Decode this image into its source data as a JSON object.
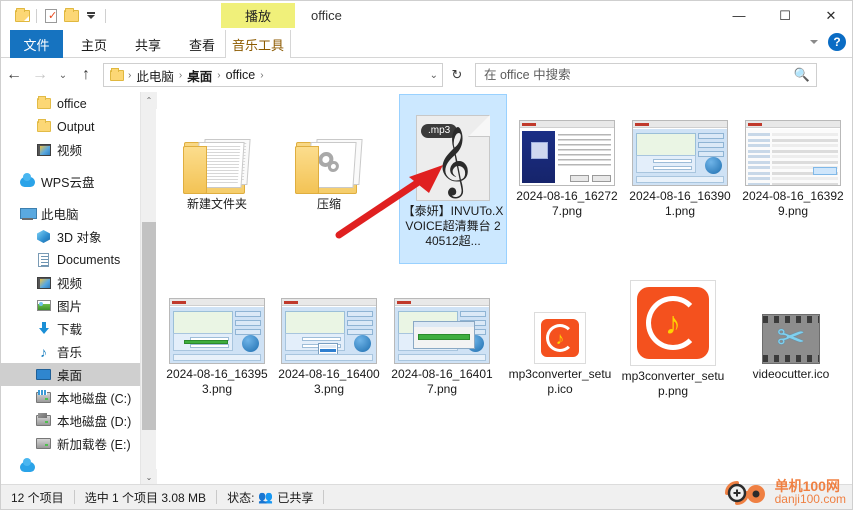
{
  "window": {
    "title": "office",
    "contextual_tab_group": "播放",
    "minimize": "—",
    "maximize": "☐",
    "close": "✕"
  },
  "quick_access": {
    "folder_icon": "folder-icon",
    "properties_icon": "properties-icon",
    "new_folder_icon": "new-folder-icon",
    "customize_icon": "customize-dropdown-icon"
  },
  "ribbon": {
    "tabs": [
      {
        "label": "文件",
        "active": true
      },
      {
        "label": "主页",
        "active": false
      },
      {
        "label": "共享",
        "active": false
      },
      {
        "label": "查看",
        "active": false
      },
      {
        "label": "音乐工具",
        "active": false
      }
    ],
    "collapse_icon": "chevron-down-icon",
    "help_label": "?"
  },
  "address": {
    "back_icon": "←",
    "forward_icon": "→",
    "recent_icon": "⌄",
    "up_icon": "↑",
    "breadcrumbs": [
      "此电脑",
      "桌面",
      "office"
    ],
    "separator": "›",
    "dropdown_icon": "⌄",
    "refresh_icon": "↻"
  },
  "search": {
    "placeholder": "在 office 中搜索",
    "value": "",
    "icon": "search-icon"
  },
  "sidebar": {
    "items": [
      {
        "label": "office",
        "icon": "folder-icon",
        "indent": 2,
        "selected": false
      },
      {
        "label": "Output",
        "icon": "folder-icon",
        "indent": 2,
        "selected": false
      },
      {
        "label": "视频",
        "icon": "video-icon",
        "indent": 2,
        "selected": false
      },
      {
        "label": "WPS云盘",
        "icon": "cloud-icon",
        "indent": 1,
        "selected": false
      },
      {
        "label": "此电脑",
        "icon": "pc-icon",
        "indent": 1,
        "selected": false
      },
      {
        "label": "3D 对象",
        "icon": "3d-objects-icon",
        "indent": 2,
        "selected": false
      },
      {
        "label": "Documents",
        "icon": "documents-icon",
        "indent": 2,
        "selected": false
      },
      {
        "label": "视频",
        "icon": "video-icon",
        "indent": 2,
        "selected": false
      },
      {
        "label": "图片",
        "icon": "pictures-icon",
        "indent": 2,
        "selected": false
      },
      {
        "label": "下载",
        "icon": "downloads-icon",
        "indent": 2,
        "selected": false
      },
      {
        "label": "音乐",
        "icon": "music-icon",
        "indent": 2,
        "selected": false
      },
      {
        "label": "桌面",
        "icon": "desktop-icon",
        "indent": 2,
        "selected": true
      },
      {
        "label": "本地磁盘 (C:)",
        "icon": "system-disk-icon",
        "indent": 2,
        "selected": false
      },
      {
        "label": "本地磁盘 (D:)",
        "icon": "disk-icon",
        "indent": 2,
        "selected": false
      },
      {
        "label": "新加载卷 (E:)",
        "icon": "disk-icon",
        "indent": 2,
        "selected": false
      }
    ],
    "scroll_up_icon": "⌃",
    "scroll_down_icon": "⌄"
  },
  "files": [
    {
      "name": "新建文件夹",
      "kind": "folder-docs",
      "selected": false
    },
    {
      "name": "压缩",
      "kind": "folder-gears",
      "selected": false
    },
    {
      "name": "【泰妍】INVUTo.XVOICE超清舞台 240512超...",
      "kind": "mp3",
      "badge": ".mp3",
      "selected": true
    },
    {
      "name": "2024-08-16_162727.png",
      "kind": "png-installer",
      "selected": false
    },
    {
      "name": "2024-08-16_163901.png",
      "kind": "png-converter",
      "selected": false
    },
    {
      "name": "2024-08-16_163929.png",
      "kind": "png-explorer",
      "selected": false
    },
    {
      "name": "2024-08-16_163953.png",
      "kind": "png-converter-b",
      "selected": false
    },
    {
      "name": "2024-08-16_164003.png",
      "kind": "png-converter-c",
      "selected": false
    },
    {
      "name": "2024-08-16_164017.png",
      "kind": "png-converter-d",
      "selected": false
    },
    {
      "name": "mp3converter_setup.ico",
      "kind": "ico-small",
      "selected": false
    },
    {
      "name": "mp3converter_setup.png",
      "kind": "ico-large",
      "selected": false
    },
    {
      "name": "videocutter.ico",
      "kind": "ico-cutter",
      "selected": false
    }
  ],
  "status": {
    "item_count": "12 个项目",
    "selection": "选中 1 个项目  3.08 MB",
    "state_label": "状态:",
    "state_value": "已共享",
    "shared_icon": "shared-people-icon"
  },
  "watermark": {
    "line1": "单机100网",
    "line2": "danji100.com"
  },
  "colors": {
    "file_tab": "#1673c0",
    "contextual_tab": "#f0f07a",
    "selection": "#cce8ff",
    "annotation_arrow": "#e02020",
    "app_icon": "#f4511e"
  }
}
